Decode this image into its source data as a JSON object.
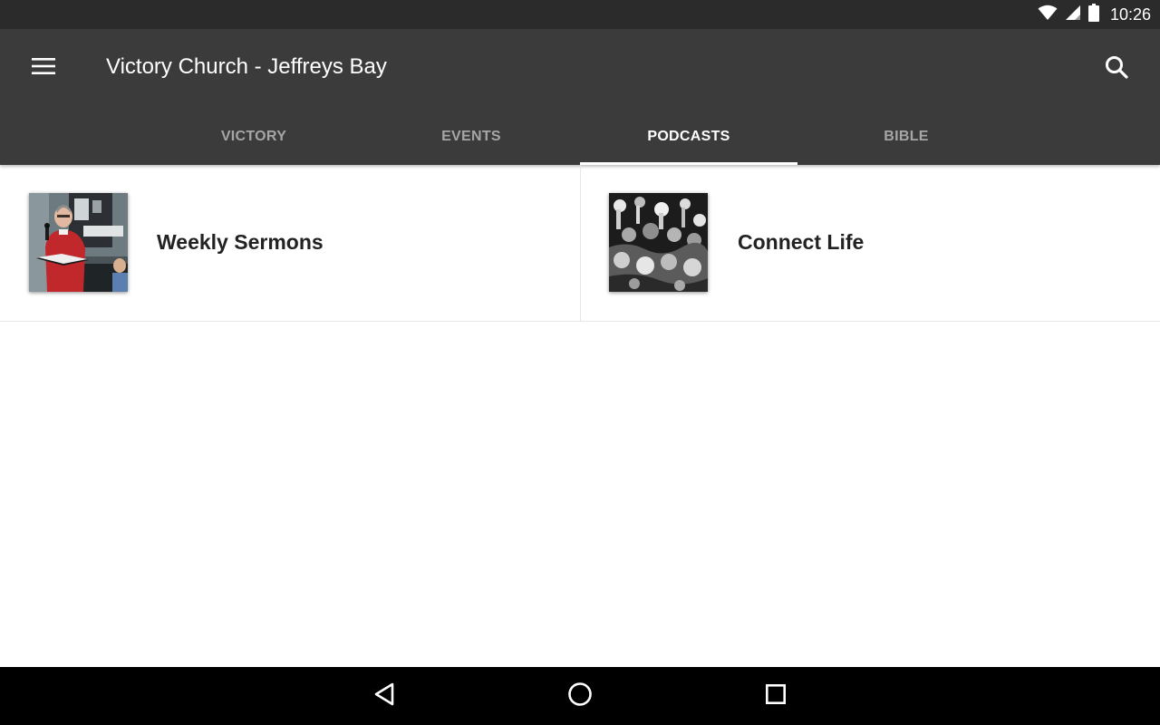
{
  "status_bar": {
    "time": "10:26",
    "icons": [
      "wifi-icon",
      "signal-icon",
      "battery-icon"
    ]
  },
  "app_bar": {
    "title": "Victory Church - Jeffreys Bay",
    "menu_icon": "menu-icon",
    "search_icon": "search-icon",
    "tabs": [
      {
        "label": "VICTORY",
        "active": false
      },
      {
        "label": "EVENTS",
        "active": false
      },
      {
        "label": "PODCASTS",
        "active": true
      },
      {
        "label": "BIBLE",
        "active": false
      }
    ]
  },
  "podcasts": [
    {
      "title": "Weekly Sermons",
      "thumbnail": "preacher-photo"
    },
    {
      "title": "Connect Life",
      "thumbnail": "worship-crowd-photo"
    }
  ],
  "nav_bar": {
    "icons": [
      "back-icon",
      "home-icon",
      "recents-icon"
    ]
  },
  "colors": {
    "status_bar": "#2b2b2b",
    "app_bar": "#3b3b3b",
    "tab_active": "#ffffff",
    "tab_inactive": "#a6a6a6",
    "nav_bar": "#000000"
  }
}
